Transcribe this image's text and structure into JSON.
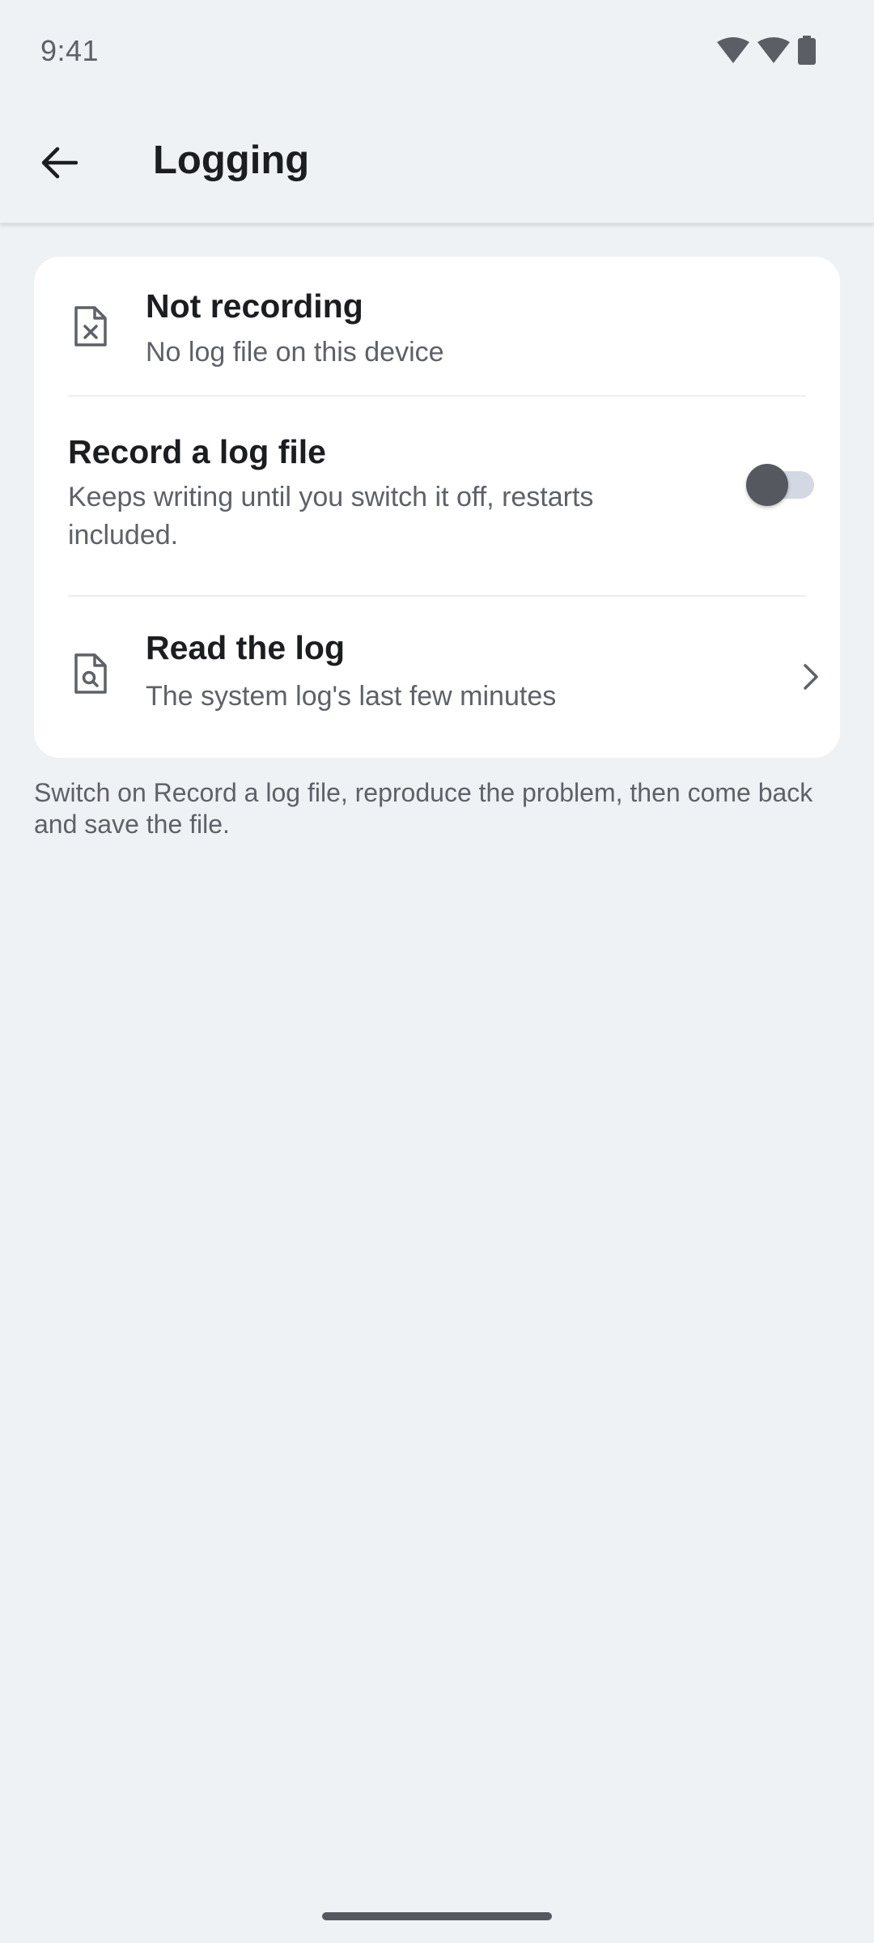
{
  "status_bar": {
    "time": "9:41",
    "icons": [
      "wifi-icon",
      "signal-icon",
      "battery-icon"
    ]
  },
  "app_bar": {
    "back_icon": "arrow-back-icon",
    "title": "Logging"
  },
  "status_row": {
    "icon": "file-x-icon",
    "title": "Not recording",
    "subtitle": "No log file on this device"
  },
  "record_row": {
    "title": "Record a log file",
    "subtitle": "Keeps writing until you switch it off, restarts included.",
    "toggle_on": false
  },
  "read_row": {
    "icon": "file-search-icon",
    "title": "Read the log",
    "subtitle": "The system log's last few minutes",
    "trailing_icon": "chevron-right-icon"
  },
  "footnote": "Switch on Record a log file, reproduce the problem, then come back and save the file.",
  "colors": {
    "background": "#eff2f5",
    "card": "#ffffff",
    "text_primary": "#1c1d20",
    "text_secondary": "#5e6167",
    "toggle_thumb_off": "#55585e",
    "toggle_track_off": "#d3d8e2"
  }
}
